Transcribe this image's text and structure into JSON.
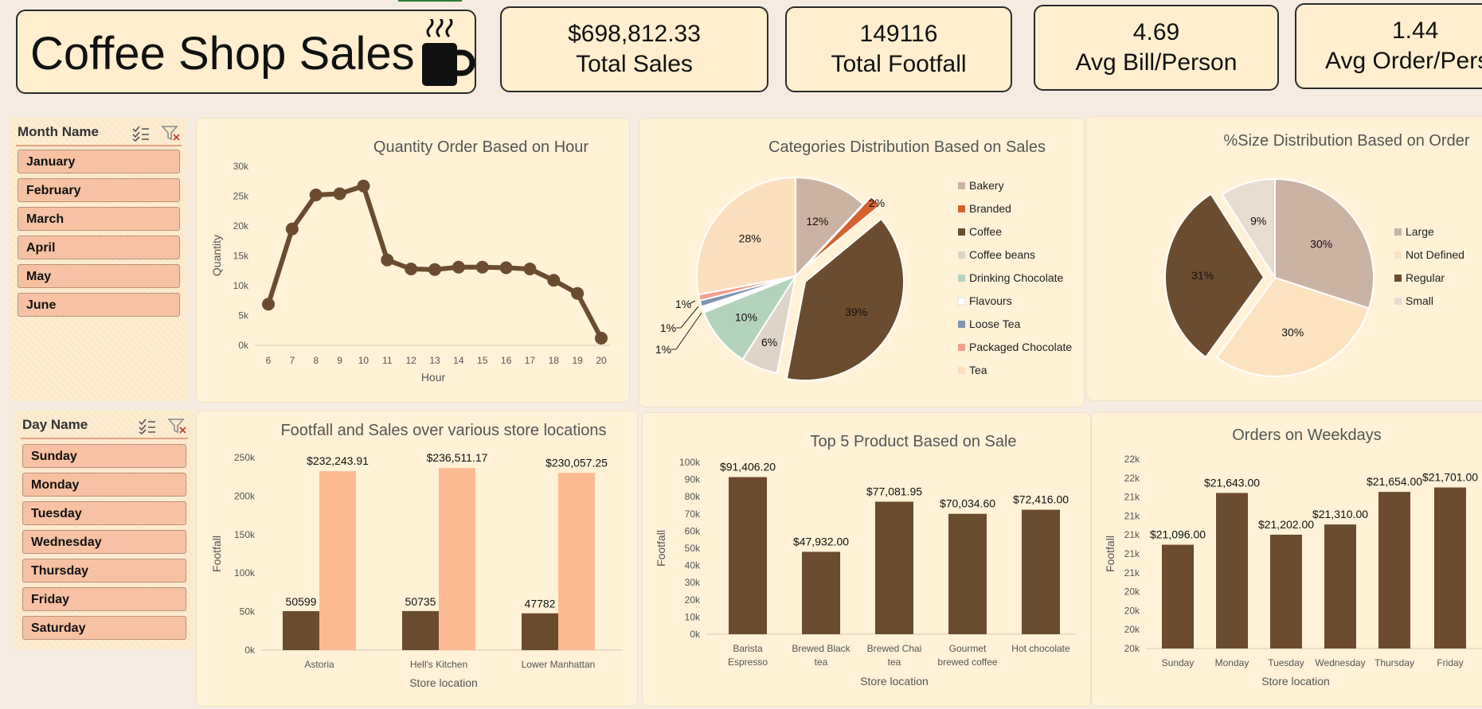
{
  "header": {
    "title": "Coffee Shop Sales",
    "icon": "coffee-mug-icon"
  },
  "kpis": [
    {
      "value": "$698,812.33",
      "label": "Total Sales"
    },
    {
      "value": "149116",
      "label": "Total Footfall"
    },
    {
      "value": "4.69",
      "label": "Avg Bill/Person"
    },
    {
      "value": "1.44",
      "label": "Avg Order/Person"
    }
  ],
  "slicers": {
    "month": {
      "title": "Month Name",
      "items": [
        "January",
        "February",
        "March",
        "April",
        "May",
        "June"
      ]
    },
    "day": {
      "title": "Day Name",
      "items": [
        "Sunday",
        "Monday",
        "Tuesday",
        "Wednesday",
        "Thursday",
        "Friday",
        "Saturday"
      ]
    }
  },
  "colors": {
    "dark_brown": "#6b4c2e",
    "peach": "#fdbb93",
    "panel_bg": "#fff2d6",
    "pie": [
      "#cbb3a4",
      "#d5622d",
      "#6b4c2e",
      "#dfd4c8",
      "#b4d3bd",
      "#ffffff",
      "#7e94b0",
      "#f2a08a",
      "#fce0be"
    ]
  },
  "chart_data": [
    {
      "type": "line",
      "title": "Quantity Order Based on Hour",
      "xlabel": "Hour",
      "ylabel": "Quantity",
      "x": [
        6,
        7,
        8,
        9,
        10,
        11,
        12,
        13,
        14,
        15,
        16,
        17,
        18,
        19,
        20
      ],
      "values": [
        6900,
        19500,
        25200,
        25400,
        26700,
        14300,
        12800,
        12700,
        13100,
        13100,
        13000,
        12800,
        10900,
        8700,
        1200
      ],
      "ylim": [
        0,
        30000
      ],
      "yticks": [
        "0k",
        "5k",
        "10k",
        "15k",
        "20k",
        "25k",
        "30k"
      ]
    },
    {
      "type": "pie",
      "title": "Categories Distribution Based on Sales",
      "categories": [
        "Bakery",
        "Branded",
        "Coffee",
        "Coffee beans",
        "Drinking Chocolate",
        "Flavours",
        "Loose Tea",
        "Packaged Chocolate",
        "Tea"
      ],
      "values": [
        12,
        2,
        39,
        6,
        10,
        1,
        1,
        1,
        28
      ],
      "labels": [
        "12%",
        "2%",
        "39%",
        "6%",
        "10%",
        "1%",
        "1%",
        "1%",
        "28%"
      ],
      "legend": "right"
    },
    {
      "type": "pie",
      "title": "%Size Distribution Based on Order",
      "categories": [
        "Large",
        "Not Defined",
        "Regular",
        "Small"
      ],
      "values": [
        30,
        30,
        31,
        9
      ],
      "labels": [
        "30%",
        "30%",
        "31%",
        "9%"
      ],
      "legend": "right"
    },
    {
      "type": "bar",
      "title": "Footfall and Sales over various store locations",
      "xlabel": "Store location",
      "ylabel": "Footfall",
      "categories": [
        "Astoria",
        "Hell's Kitchen",
        "Lower Manhattan"
      ],
      "series": [
        {
          "values": [
            50599,
            50735,
            47782
          ],
          "labels": [
            "50599",
            "50735",
            "47782"
          ]
        },
        {
          "values": [
            232243.91,
            236511.17,
            230057.25
          ],
          "labels": [
            "$232,243.91",
            "$236,511.17",
            "$230,057.25"
          ]
        }
      ],
      "ylim": [
        0,
        250000
      ],
      "yticks": [
        "0k",
        "50k",
        "100k",
        "150k",
        "200k",
        "250k"
      ]
    },
    {
      "type": "bar",
      "title": "Top 5 Product Based on Sale",
      "xlabel": "Store location",
      "ylabel": "Footfall",
      "categories": [
        [
          "Barista",
          "Espresso"
        ],
        [
          "Brewed Black",
          "tea"
        ],
        [
          "Brewed Chai",
          "tea"
        ],
        [
          "Gourmet",
          "brewed coffee"
        ],
        [
          "Hot chocolate"
        ]
      ],
      "values": [
        91406.2,
        47932.0,
        77081.95,
        70034.6,
        72416.0
      ],
      "labels": [
        "$91,406.20",
        "$47,932.00",
        "$77,081.95",
        "$70,034.60",
        "$72,416.00"
      ],
      "ylim": [
        0,
        100000
      ],
      "yticks": [
        "0k",
        "10k",
        "20k",
        "30k",
        "40k",
        "50k",
        "60k",
        "70k",
        "80k",
        "90k",
        "100k"
      ]
    },
    {
      "type": "bar",
      "title": "Orders on Weekdays",
      "xlabel": "Store location",
      "ylabel": "Footfall",
      "categories": [
        "Sunday",
        "Monday",
        "Tuesday",
        "Wednesday",
        "Thursday",
        "Friday"
      ],
      "values": [
        21096,
        21643,
        21202,
        21310,
        21654,
        21701
      ],
      "labels": [
        "$21,096.00",
        "$21,643.00",
        "$21,202.00",
        "$21,310.00",
        "$21,654.00",
        "$21,701.00"
      ],
      "ylim": [
        20000,
        22000
      ],
      "yticks": [
        "20k",
        "20k",
        "20k",
        "20k",
        "21k",
        "21k",
        "21k",
        "21k",
        "21k",
        "22k",
        "22k"
      ]
    }
  ]
}
